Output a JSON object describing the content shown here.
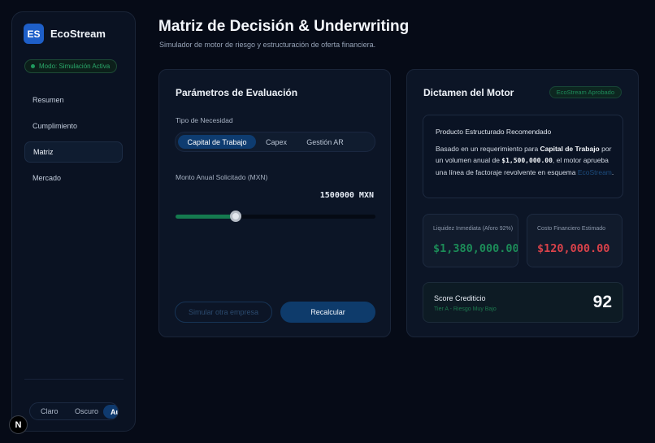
{
  "brand": {
    "initials": "ES",
    "name": "EcoStream"
  },
  "sidebar": {
    "mode_badge": "Modo: Simulación Activa",
    "nav": [
      {
        "label": "Resumen",
        "active": false
      },
      {
        "label": "Cumplimiento",
        "active": false
      },
      {
        "label": "Matriz",
        "active": true
      },
      {
        "label": "Mercado",
        "active": false
      }
    ],
    "theme": {
      "light": "Claro",
      "dark": "Oscuro",
      "auto": "Auto",
      "selected": "Auto"
    }
  },
  "framework_badge": "N",
  "header": {
    "title": "Matriz de Decisión & Underwriting",
    "subtitle": "Simulador de motor de riesgo y estructuración de oferta financiera."
  },
  "params": {
    "title": "Parámetros de Evaluación",
    "need_label": "Tipo de Necesidad",
    "need_options": [
      "Capital de Trabajo",
      "Capex",
      "Gestión AR"
    ],
    "need_selected": "Capital de Trabajo",
    "amount_label": "Monto Anual Solicitado (MXN)",
    "amount_value": "1500000 MXN",
    "slider": {
      "value": 1500000,
      "min": 0,
      "max": 5000000
    },
    "simulate_label": "Simular otra empresa",
    "recalc_label": "Recalcular"
  },
  "verdict": {
    "title": "Dictamen del Motor",
    "badge": "EcoStream Aprobado",
    "product": {
      "title": "Producto Estructurado Recomendado",
      "text_1": "Basado en un requerimiento para ",
      "need": "Capital de Trabajo",
      "text_2": " por un volumen anual de ",
      "amount": "$1,500,000.00",
      "text_3": ", el motor aprueba una línea de factoraje revolvente en esquema ",
      "scheme": "EcoStream",
      "text_4": "."
    },
    "liquidity": {
      "label": "Liquidez Inmediata (Aforo 92%)",
      "value": "$1,380,000.00"
    },
    "cost": {
      "label": "Costo Financiero Estimado",
      "value": "$120,000.00"
    },
    "score": {
      "label": "Score Crediticio",
      "tier": "Tier A - Riesgo Muy Bajo",
      "value": "92"
    }
  },
  "colors": {
    "background": "#060b17",
    "accent": "#0e3b6b",
    "positive": "#1c8c58",
    "negative": "#d9424a"
  }
}
